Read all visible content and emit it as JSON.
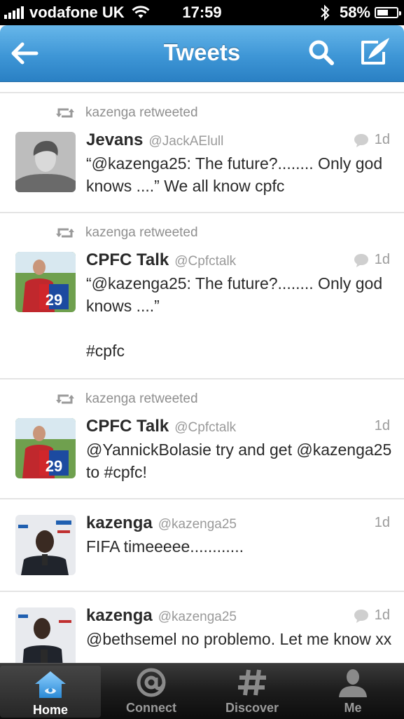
{
  "status_bar": {
    "carrier": "vodafone UK",
    "time": "17:59",
    "battery_percent": "58%",
    "battery_level": 0.58,
    "icons": [
      "signal-bars-icon",
      "wifi-icon",
      "bluetooth-icon",
      "battery-icon"
    ]
  },
  "nav": {
    "title": "Tweets",
    "icons": [
      "back-arrow-icon",
      "search-icon",
      "compose-icon"
    ]
  },
  "tweets": [
    {
      "retweeted_by": "kazenga retweeted",
      "name": "Jevans",
      "handle": "@JackAElull",
      "time": "1d",
      "has_reply_icon": true,
      "text": "“@kazenga25: The future?........  Only god knows ....” We all know cpfc"
    },
    {
      "retweeted_by": "kazenga retweeted",
      "name": "CPFC Talk",
      "handle": "@Cpfctalk",
      "time": "1d",
      "has_reply_icon": true,
      "text": "“@kazenga25: The future?........  Only god knows ....”\n\n#cpfc"
    },
    {
      "retweeted_by": "kazenga retweeted",
      "name": "CPFC Talk",
      "handle": "@Cpfctalk",
      "time": "1d",
      "has_reply_icon": false,
      "text": "@YannickBolasie try and get @kazenga25 to #cpfc!"
    },
    {
      "retweeted_by": "",
      "name": "kazenga",
      "handle": "@kazenga25",
      "time": "1d",
      "has_reply_icon": false,
      "text": "FIFA timeeeee............"
    },
    {
      "retweeted_by": "",
      "name": "kazenga",
      "handle": "@kazenga25",
      "time": "1d",
      "has_reply_icon": true,
      "text": "@bethsemel no problemo. Let me know xx"
    }
  ],
  "tabs": [
    {
      "label": "Home",
      "icon": "home-icon",
      "active": true
    },
    {
      "label": "Connect",
      "icon": "at-sign-icon",
      "active": false
    },
    {
      "label": "Discover",
      "icon": "hashtag-icon",
      "active": false
    },
    {
      "label": "Me",
      "icon": "person-icon",
      "active": false
    }
  ],
  "colors": {
    "nav_blue": "#3e96d6",
    "tab_active_blue": "#4aa8e8",
    "meta_gray": "#9a9a9a"
  }
}
